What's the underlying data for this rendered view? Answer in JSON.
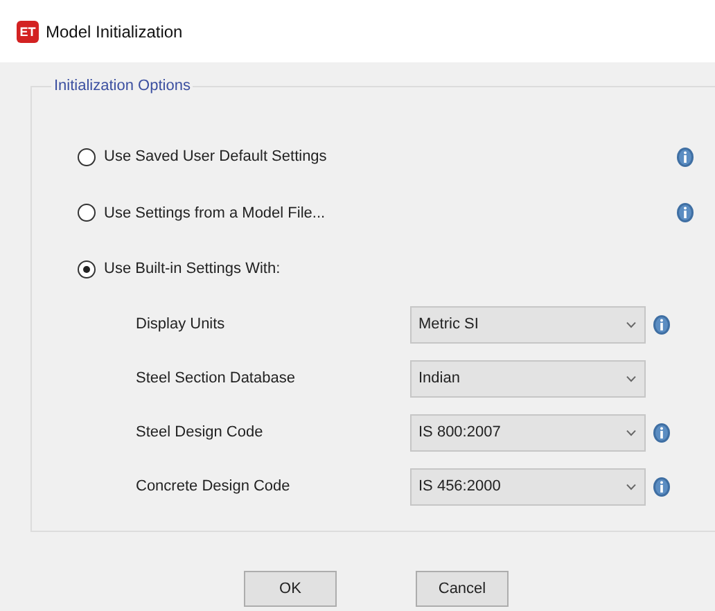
{
  "window": {
    "app_badge": "ET",
    "title": "Model Initialization"
  },
  "group": {
    "title": "Initialization Options",
    "options": [
      {
        "label": "Use Saved User Default Settings",
        "selected": false,
        "info": true
      },
      {
        "label": "Use Settings from a Model File...",
        "selected": false,
        "info": true
      },
      {
        "label": "Use Built-in Settings With:",
        "selected": true,
        "info": false
      }
    ],
    "settings": [
      {
        "label": "Display Units",
        "value": "Metric SI",
        "info": true
      },
      {
        "label": "Steel Section Database",
        "value": "Indian",
        "info": false
      },
      {
        "label": "Steel Design Code",
        "value": "IS 800:2007",
        "info": true
      },
      {
        "label": "Concrete Design Code",
        "value": "IS 456:2000",
        "info": true
      }
    ]
  },
  "buttons": [
    "OK",
    "Cancel"
  ]
}
